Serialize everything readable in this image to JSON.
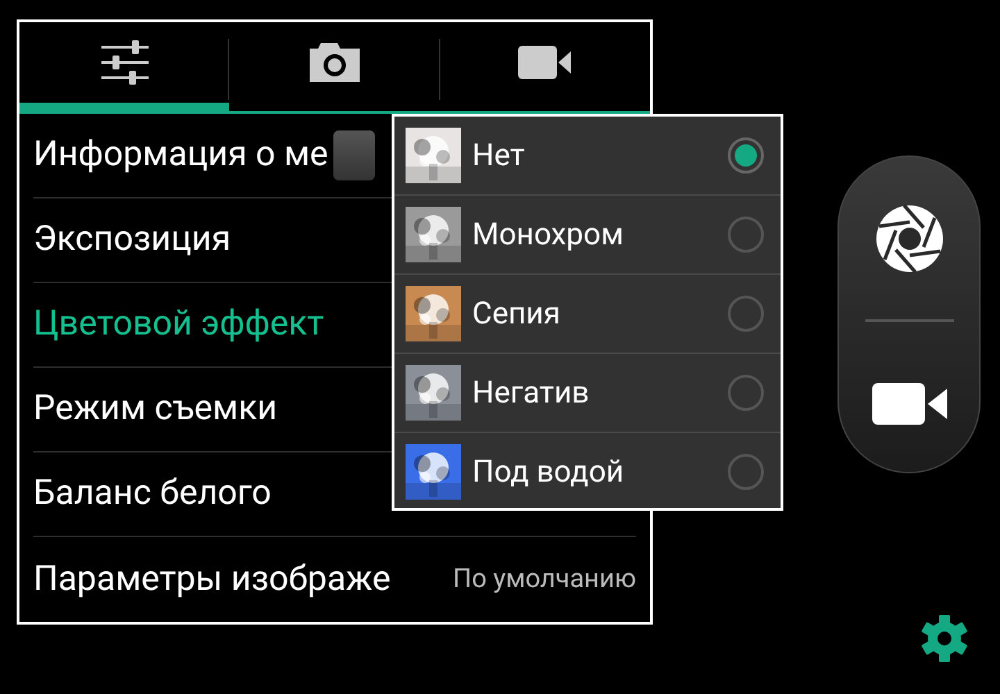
{
  "tabs": [
    {
      "kind": "sliders",
      "selected": true
    },
    {
      "kind": "camera",
      "selected": false
    },
    {
      "kind": "video",
      "selected": false
    }
  ],
  "settings": [
    {
      "label": "Информация о ме",
      "kind": "toggle",
      "checked": false,
      "highlighted": false
    },
    {
      "label": "Экспозиция",
      "highlighted": false
    },
    {
      "label": "Цветовой эффект",
      "highlighted": true
    },
    {
      "label": "Режим съемки",
      "highlighted": false
    },
    {
      "label": "Баланс белого",
      "highlighted": false
    },
    {
      "label": "Параметры изображе",
      "value": "По умолчанию",
      "highlighted": false
    }
  ],
  "effects_popup": {
    "options": [
      {
        "label": "Нет",
        "selected": true
      },
      {
        "label": "Монохром",
        "selected": false
      },
      {
        "label": "Сепия",
        "selected": false
      },
      {
        "label": "Негатив",
        "selected": false
      },
      {
        "label": "Под водой",
        "selected": false
      }
    ]
  }
}
